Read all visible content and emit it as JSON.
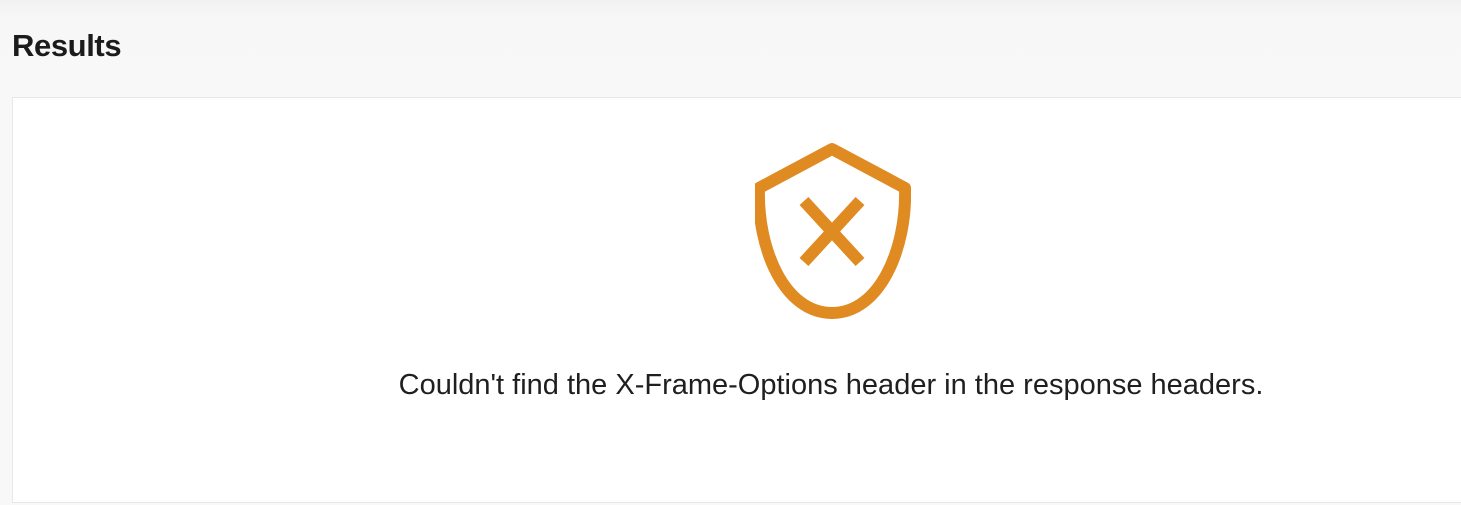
{
  "header": {
    "title": "Results"
  },
  "result": {
    "status_icon": "shield-x-icon",
    "accent_color": "#e08a22",
    "message": "Couldn't find the X-Frame-Options header in the response headers."
  }
}
